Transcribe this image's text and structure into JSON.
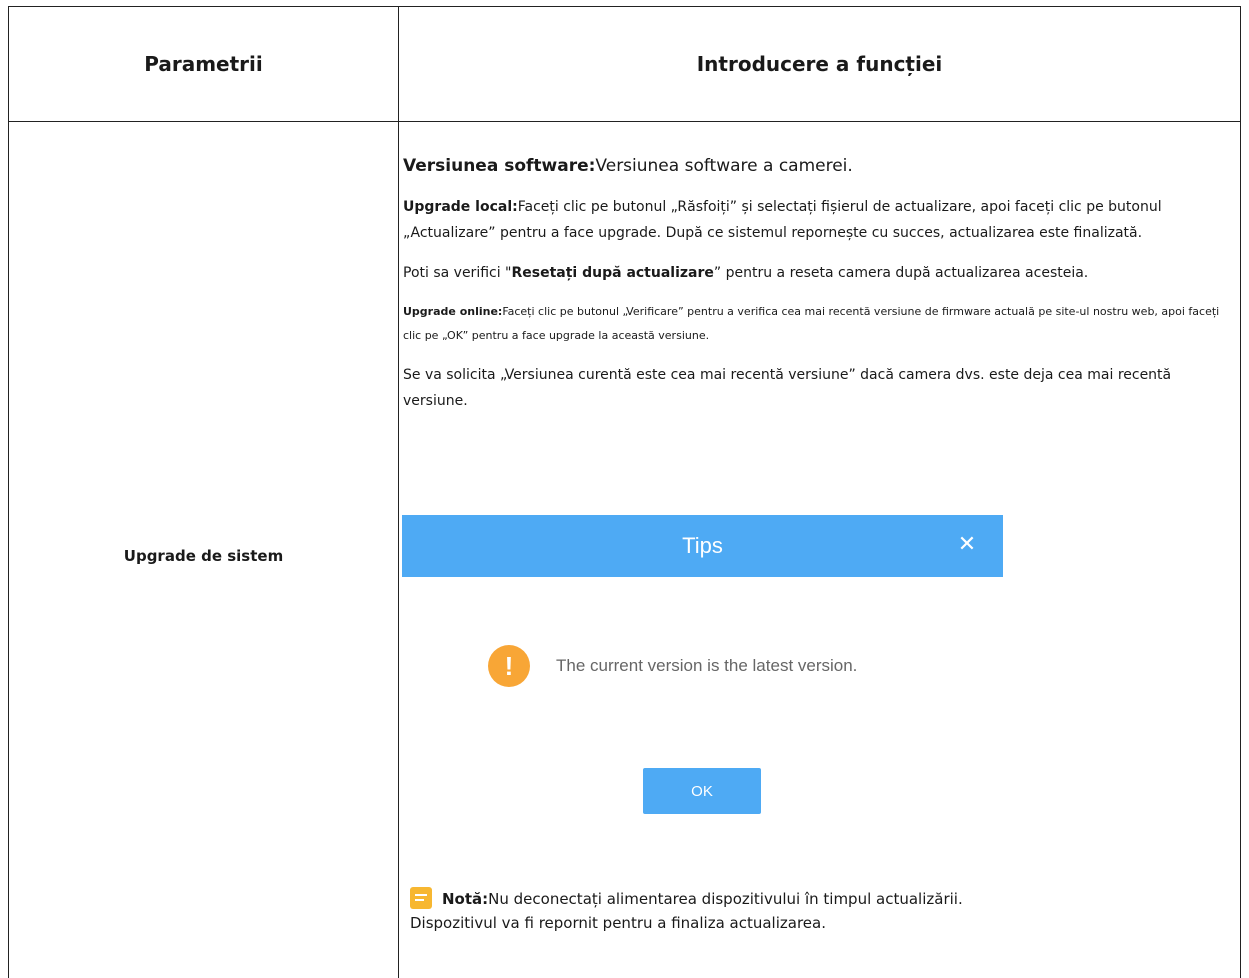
{
  "header": {
    "col1": "Parametrii",
    "col2": "Introducere a funcției"
  },
  "row": {
    "param": "Upgrade de sistem"
  },
  "content": {
    "software_label": "Versiunea software:",
    "software_text": "Versiunea software a camerei.",
    "local_label": "Upgrade local:",
    "local_text": "Faceți clic pe butonul „Răsfoiți” și selectați fișierul de actualizare, apoi faceți clic pe butonul „Actualizare” pentru a face upgrade. După ce sistemul repornește cu succes, actualizarea este finalizată.",
    "reset_prefix": "Poti sa verifici \"",
    "reset_bold": "Resetați după actualizare",
    "reset_suffix": "” pentru a reseta camera după actualizarea acesteia.",
    "online_label": "Upgrade online:",
    "online_text": "Faceți clic pe butonul „Verificare” pentru a verifica cea mai recentă versiune de firmware actuală pe site-ul nostru web, apoi faceți clic pe „OK” pentru a face upgrade la această versiune.",
    "prompt_text": "Se va solicita „Versiunea curentă este cea mai recentă versiune” dacă camera dvs. este deja cea mai recentă versiune."
  },
  "dialog": {
    "title": "Tips",
    "close_glyph": "✕",
    "warning_glyph": "!",
    "message": "The current version is the latest version.",
    "ok_label": "OK",
    "header_color": "#4eaaf4",
    "warning_color": "#f8a636"
  },
  "note": {
    "icon": "note-icon",
    "label": "Notă:",
    "line1": "Nu deconectați alimentarea dispozitivului în timpul actualizării.",
    "line2": "Dispozitivul va fi repornit pentru a finaliza actualizarea."
  }
}
